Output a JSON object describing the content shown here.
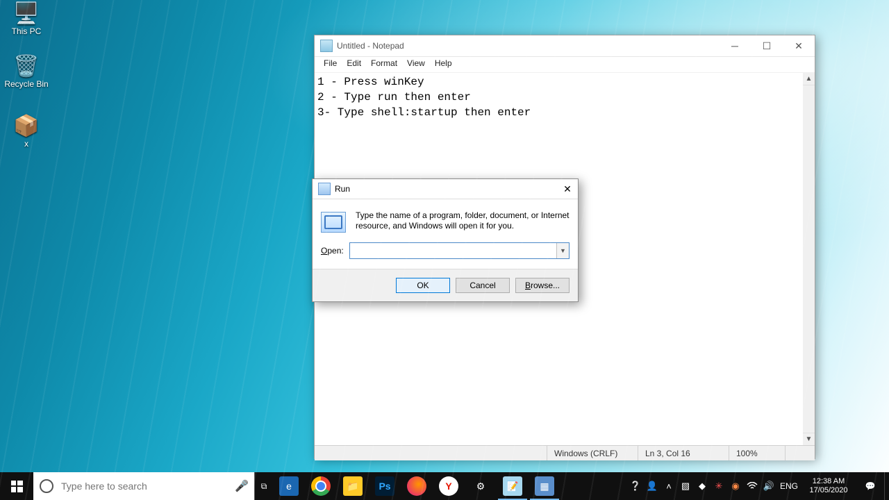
{
  "desktop": {
    "icons": {
      "this_pc": "This PC",
      "recycle_bin": "Recycle Bin",
      "x": "x"
    }
  },
  "notepad": {
    "title": "Untitled - Notepad",
    "menu": {
      "file": "File",
      "edit": "Edit",
      "format": "Format",
      "view": "View",
      "help": "Help"
    },
    "content": "1 - Press winKey\n2 - Type run then enter\n3- Type shell:startup then enter",
    "status": {
      "encoding": "Windows (CRLF)",
      "pos": "Ln 3, Col 16",
      "zoom": "100%"
    }
  },
  "run": {
    "title": "Run",
    "description": "Type the name of a program, folder, document, or Internet resource, and Windows will open it for you.",
    "open_label": "Open:",
    "open_value": "",
    "ok": "OK",
    "cancel": "Cancel",
    "browse": "Browse..."
  },
  "taskbar": {
    "search_placeholder": "Type here to search",
    "lang": "ENG",
    "time": "12:38 AM",
    "date": "17/05/2020"
  }
}
